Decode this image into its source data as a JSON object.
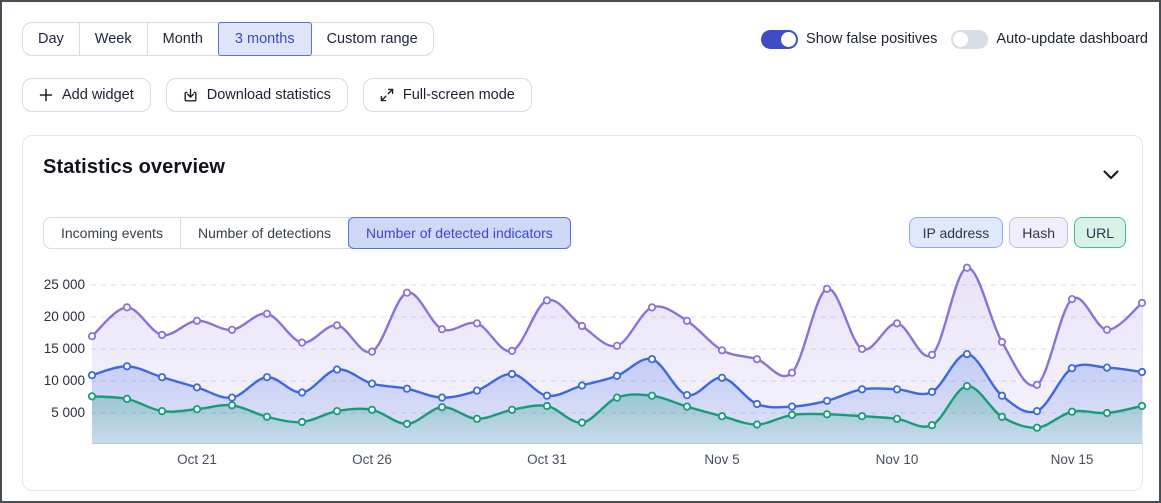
{
  "time_range": {
    "items": [
      {
        "label": "Day",
        "selected": false
      },
      {
        "label": "Week",
        "selected": false
      },
      {
        "label": "Month",
        "selected": false
      },
      {
        "label": "3 months",
        "selected": true
      },
      {
        "label": "Custom range",
        "selected": false
      }
    ]
  },
  "toggles": {
    "false_positives": {
      "label": "Show false positives",
      "state": "on"
    },
    "auto_update": {
      "label": "Auto-update dashboard",
      "state": "off"
    }
  },
  "actions": {
    "add_widget": "Add widget",
    "download_statistics": "Download statistics",
    "fullscreen": "Full-screen mode"
  },
  "card": {
    "title": "Statistics overview",
    "tabs": [
      {
        "label": "Incoming events",
        "selected": false
      },
      {
        "label": "Number of detections",
        "selected": false
      },
      {
        "label": "Number of detected indicators",
        "selected": true
      }
    ],
    "chips": [
      {
        "label": "IP address",
        "color": "#3d68e0"
      },
      {
        "label": "Hash",
        "color": "#8b72d9"
      },
      {
        "label": "URL",
        "color": "#179c78"
      }
    ]
  },
  "colors": {
    "accent_blue": "#3a49c6",
    "toggle_on": "#3f4dc5",
    "toggle_off": "#d8dce6",
    "selected_segment_bg": "#dee5fb",
    "selected_tab_bg": "#cdd9f7"
  },
  "chart_data": {
    "type": "line",
    "title": "Number of detected indicators",
    "grid": "dashed-horizontal",
    "legend_position": "top-right-chips",
    "n_points": 31,
    "x_tick_labels": [
      "Oct 21",
      "Oct 26",
      "Oct 31",
      "Nov 5",
      "Nov 10",
      "Nov 15"
    ],
    "x_tick_indices": [
      3,
      8,
      13,
      18,
      23,
      28
    ],
    "y_ticks": [
      {
        "value": 5000,
        "label": "5 000"
      },
      {
        "value": 10000,
        "label": "10 000"
      },
      {
        "value": 15000,
        "label": "15 000"
      },
      {
        "value": 20000,
        "label": "20 000"
      },
      {
        "value": 25000,
        "label": "25 000"
      }
    ],
    "ylim": [
      0,
      28000
    ],
    "series": [
      {
        "name": "Hash",
        "color": "#8b72d9",
        "values": [
          17000,
          21500,
          17200,
          19400,
          18000,
          20500,
          16000,
          18700,
          14600,
          23800,
          18100,
          19000,
          14700,
          22600,
          18600,
          15500,
          21500,
          19400,
          14800,
          13400,
          11300,
          24400,
          15000,
          19000,
          14100,
          27700,
          16100,
          9400,
          22800,
          18000,
          22200
        ]
      },
      {
        "name": "IP address",
        "color": "#3d68e0",
        "values": [
          10900,
          12300,
          10600,
          9000,
          7400,
          10600,
          8200,
          11800,
          9600,
          8800,
          7400,
          8500,
          11100,
          7700,
          9300,
          10800,
          13400,
          7800,
          10500,
          6400,
          6000,
          6900,
          8700,
          8700,
          8300,
          14200,
          7700,
          5300,
          12000,
          12100,
          11400
        ]
      },
      {
        "name": "URL",
        "color": "#179c78",
        "values": [
          7600,
          7200,
          5300,
          5600,
          6200,
          4400,
          3600,
          5300,
          5500,
          3300,
          5900,
          4100,
          5500,
          6100,
          3500,
          7400,
          7700,
          6000,
          4500,
          3200,
          4700,
          4800,
          4500,
          4100,
          3100,
          9200,
          4400,
          2700,
          5200,
          5000,
          6100
        ]
      }
    ]
  }
}
